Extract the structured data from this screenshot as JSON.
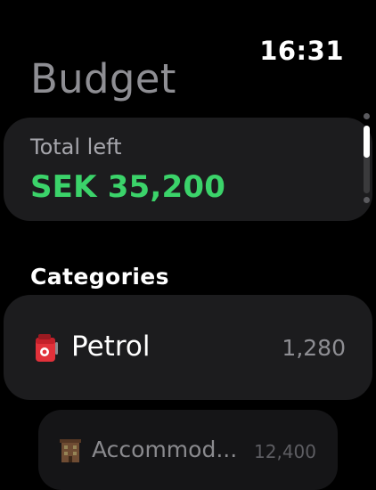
{
  "status": {
    "time": "16:31"
  },
  "header": {
    "title": "Budget"
  },
  "summary": {
    "label": "Total left",
    "value": "SEK 35,200",
    "value_color": "#3bd36a"
  },
  "categories": {
    "header": "Categories",
    "items": [
      {
        "icon": "fuel-pump-icon",
        "label": "Petrol",
        "amount": "1,280"
      },
      {
        "icon": "hotel-icon",
        "label": "Accommod...",
        "amount": "12,400"
      }
    ]
  },
  "scroll": {
    "position": 0.0
  }
}
